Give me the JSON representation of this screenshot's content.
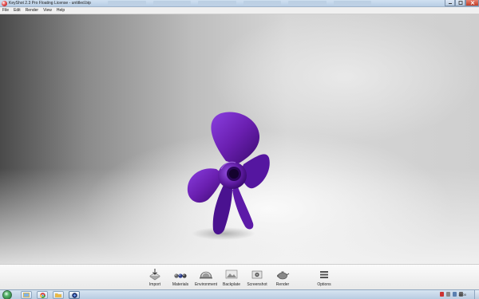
{
  "window": {
    "title": "KeyShot 2.3 Pro Floating License - untitled.bip",
    "minimize_icon": "minimize-icon",
    "maximize_icon": "maximize-icon",
    "close_icon": "close-icon"
  },
  "menu": {
    "items": [
      {
        "label": "File"
      },
      {
        "label": "Edit"
      },
      {
        "label": "Render"
      },
      {
        "label": "View"
      },
      {
        "label": "Help"
      }
    ]
  },
  "viewport": {
    "object": "propeller",
    "object_color": "#6a1fb0"
  },
  "toolbar": {
    "items": [
      {
        "label": "Import",
        "icon": "import-icon"
      },
      {
        "label": "Materials",
        "icon": "materials-icon"
      },
      {
        "label": "Environment",
        "icon": "environment-icon"
      },
      {
        "label": "Backplate",
        "icon": "backplate-icon"
      },
      {
        "label": "Screenshot",
        "icon": "screenshot-icon"
      },
      {
        "label": "Render",
        "icon": "render-icon"
      },
      {
        "label": "Options",
        "icon": "options-icon"
      }
    ]
  },
  "taskbar": {
    "apps": [
      {
        "icon": "explorer-icon"
      },
      {
        "icon": "chrome-icon"
      },
      {
        "icon": "folder-icon"
      },
      {
        "icon": "keyshot-icon"
      }
    ],
    "clock": "14:00"
  }
}
